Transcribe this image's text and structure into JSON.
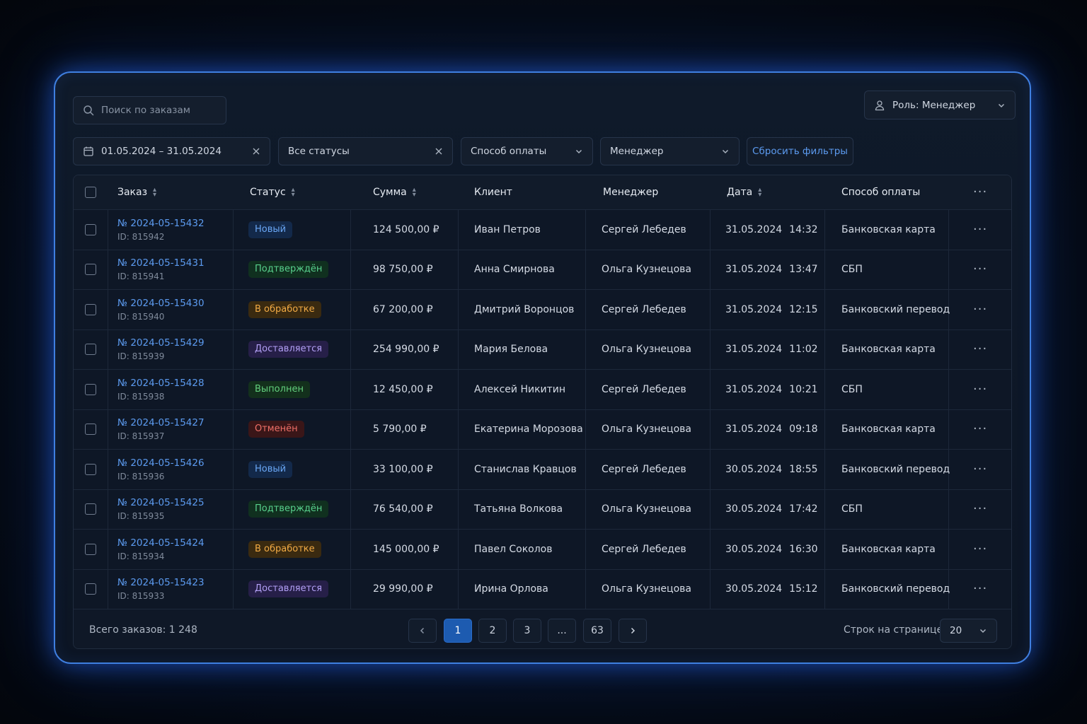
{
  "search": {
    "placeholder": "Поиск по заказам",
    "icon": "search-icon"
  },
  "role_select": {
    "label": "Роль: Менеджер"
  },
  "filters": {
    "date_range": "01.05.2024 – 31.05.2024",
    "status": "Все статусы",
    "payment": "Способ оплаты",
    "manager": "Менеджер",
    "reset": "Сбросить фильтры"
  },
  "table": {
    "columns": {
      "order": "Заказ",
      "status": "Статус",
      "amount": "Сумма",
      "client": "Клиент",
      "manager": "Менеджер",
      "date": "Дата",
      "payment": "Способ оплаты",
      "more": "···"
    },
    "rows": [
      {
        "number": "№ 2024-05-15432",
        "id": "ID: 815942",
        "status": "Новый",
        "status_kind": "new",
        "amount": "124 500,00 ₽",
        "client": "Иван Петров",
        "manager": "Сергей Лебедев",
        "date": "31.05.2024",
        "time": "14:32",
        "payment": "Банковская карта",
        "more": "···"
      },
      {
        "number": "№ 2024-05-15431",
        "id": "ID: 815941",
        "status": "Подтверждён",
        "status_kind": "confirmed",
        "amount": "98 750,00 ₽",
        "client": "Анна Смирнова",
        "manager": "Ольга Кузнецова",
        "date": "31.05.2024",
        "time": "13:47",
        "payment": "СБП",
        "more": "···"
      },
      {
        "number": "№ 2024-05-15430",
        "id": "ID: 815940",
        "status": "В обработке",
        "status_kind": "processing",
        "amount": "67 200,00 ₽",
        "client": "Дмитрий Воронцов",
        "manager": "Сергей Лебедев",
        "date": "31.05.2024",
        "time": "12:15",
        "payment": "Банковский перевод",
        "more": "···"
      },
      {
        "number": "№ 2024-05-15429",
        "id": "ID: 815939",
        "status": "Доставляется",
        "status_kind": "delivering",
        "amount": "254 990,00 ₽",
        "client": "Мария Белова",
        "manager": "Ольга Кузнецова",
        "date": "31.05.2024",
        "time": "11:02",
        "payment": "Банковская карта",
        "more": "···"
      },
      {
        "number": "№ 2024-05-15428",
        "id": "ID: 815938",
        "status": "Выполнен",
        "status_kind": "done",
        "amount": "12 450,00 ₽",
        "client": "Алексей Никитин",
        "manager": "Сергей Лебедев",
        "date": "31.05.2024",
        "time": "10:21",
        "payment": "СБП",
        "more": "···"
      },
      {
        "number": "№ 2024-05-15427",
        "id": "ID: 815937",
        "status": "Отменён",
        "status_kind": "cancel",
        "amount": "5 790,00 ₽",
        "client": "Екатерина Морозова",
        "manager": "Ольга Кузнецова",
        "date": "31.05.2024",
        "time": "09:18",
        "payment": "Банковская карта",
        "more": "···"
      },
      {
        "number": "№ 2024-05-15426",
        "id": "ID: 815936",
        "status": "Новый",
        "status_kind": "new",
        "amount": "33 100,00 ₽",
        "client": "Станислав Кравцов",
        "manager": "Сергей Лебедев",
        "date": "30.05.2024",
        "time": "18:55",
        "payment": "Банковский перевод",
        "more": "···"
      },
      {
        "number": "№ 2024-05-15425",
        "id": "ID: 815935",
        "status": "Подтверждён",
        "status_kind": "confirmed",
        "amount": "76 540,00 ₽",
        "client": "Татьяна Волкова",
        "manager": "Ольга Кузнецова",
        "date": "30.05.2024",
        "time": "17:42",
        "payment": "СБП",
        "more": "···"
      },
      {
        "number": "№ 2024-05-15424",
        "id": "ID: 815934",
        "status": "В обработке",
        "status_kind": "processing",
        "amount": "145 000,00 ₽",
        "client": "Павел Соколов",
        "manager": "Сергей Лебедев",
        "date": "30.05.2024",
        "time": "16:30",
        "payment": "Банковская карта",
        "more": "···"
      },
      {
        "number": "№ 2024-05-15423",
        "id": "ID: 815933",
        "status": "Доставляется",
        "status_kind": "delivering",
        "amount": "29 990,00 ₽",
        "client": "Ирина Орлова",
        "manager": "Ольга Кузнецова",
        "date": "30.05.2024",
        "time": "15:12",
        "payment": "Банковский перевод",
        "more": "···"
      }
    ]
  },
  "footer": {
    "total": "Всего заказов: 1 248",
    "pages": [
      "1",
      "2",
      "3",
      "...",
      "63"
    ],
    "current_page": "1",
    "rows_per_page_label": "Строк на странице:",
    "rows_per_page": "20"
  },
  "colors": {
    "accent": "#3f7fe0",
    "link": "#5c9bf0",
    "active_page": "#1d5bb0"
  }
}
